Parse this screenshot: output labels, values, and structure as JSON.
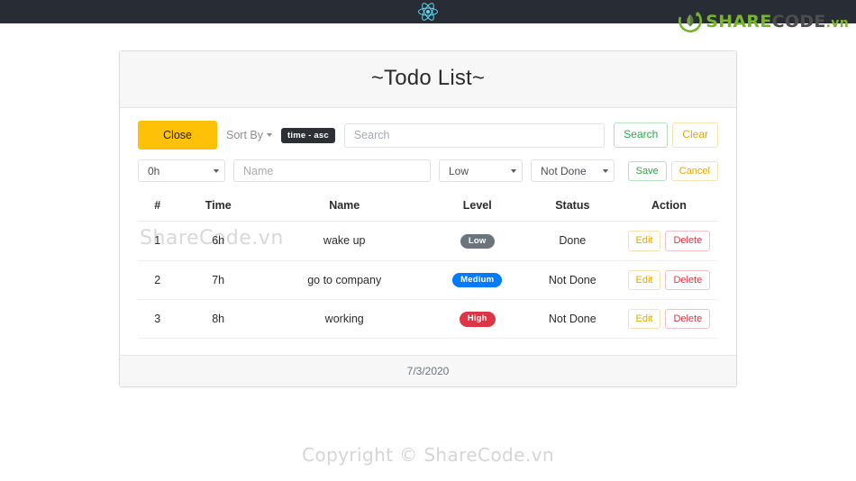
{
  "navbar": {
    "logo_icon": "react-logo-icon",
    "background": "#282c34"
  },
  "brand": {
    "icon": "sharecode-leaf-icon",
    "share": "SHARE",
    "code": "CODE",
    "vn": ".vn",
    "green": "#76b729",
    "dark": "#4d4d4d"
  },
  "card": {
    "title": "~Todo List~",
    "footer_date": "7/3/2020"
  },
  "toolbar": {
    "close_label": "Close",
    "sort_by_label": "Sort By",
    "sort_badge": "time - asc",
    "search_placeholder": "Search",
    "search_value": "",
    "search_label": "Search",
    "clear_label": "Clear"
  },
  "form": {
    "time_value": "0h",
    "name_placeholder": "Name",
    "name_value": "",
    "level_value": "Low",
    "status_value": "Not Done",
    "save_label": "Save",
    "cancel_label": "Cancel"
  },
  "table": {
    "headers": [
      "#",
      "Time",
      "Name",
      "Level",
      "Status",
      "Action"
    ],
    "rows": [
      {
        "num": "1",
        "time": "6h",
        "name": "wake up",
        "level": "Low",
        "level_class": "lv-low",
        "status": "Done",
        "status_class": "status-done",
        "edit": "Edit",
        "delete": "Delete"
      },
      {
        "num": "2",
        "time": "7h",
        "name": "go to company",
        "level": "Medium",
        "level_class": "lv-medium",
        "status": "Not Done",
        "status_class": "status-notdone",
        "edit": "Edit",
        "delete": "Delete"
      },
      {
        "num": "3",
        "time": "8h",
        "name": "working",
        "level": "High",
        "level_class": "lv-high",
        "status": "Not Done",
        "status_class": "status-notdone",
        "edit": "Edit",
        "delete": "Delete"
      }
    ]
  },
  "watermarks": {
    "table": "ShareCode.vn",
    "copyright": "Copyright © ShareCode.vn"
  },
  "colors": {
    "warning": "#ffc107",
    "success": "#28a745",
    "danger": "#dc3545",
    "primary": "#007bff",
    "secondary": "#6c757d"
  }
}
